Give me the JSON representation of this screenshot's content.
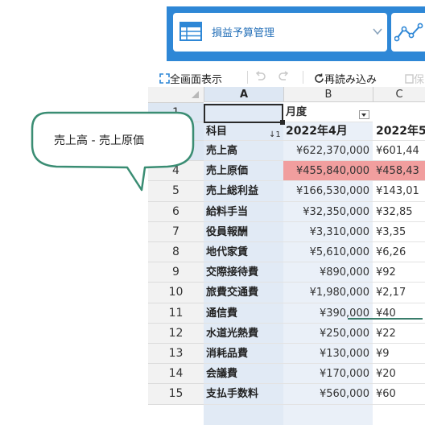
{
  "header": {
    "view_label": "損益予算管理",
    "colors": {
      "header_bg": "#2e87d6",
      "view_text": "#2570b8"
    }
  },
  "toolbar": {
    "fullscreen_label": "全画面表示",
    "reload_label": "再読み込み",
    "save_label": "保"
  },
  "sheet": {
    "columns": [
      "A",
      "B",
      "C"
    ],
    "header_row": {
      "row": "1",
      "b": "月度"
    },
    "label_row": {
      "row": "2",
      "a": "科目",
      "b": "2022年4月",
      "c": "2022年5"
    },
    "rows": [
      {
        "row": "3",
        "a": "売上高",
        "b": "¥622,370,000",
        "c": "¥601,44"
      },
      {
        "row": "4",
        "a": "売上原価",
        "b": "¥455,840,000",
        "c": "¥458,43"
      },
      {
        "row": "5",
        "a": "売上総利益",
        "b": "¥166,530,000",
        "c": "¥143,01"
      },
      {
        "row": "6",
        "a": "給料手当",
        "b": "¥32,350,000",
        "c": "¥32,85"
      },
      {
        "row": "7",
        "a": "役員報酬",
        "b": "¥3,310,000",
        "c": "¥3,35"
      },
      {
        "row": "8",
        "a": "地代家賃",
        "b": "¥5,610,000",
        "c": "¥6,26"
      },
      {
        "row": "9",
        "a": "交際接待費",
        "b": "¥890,000",
        "c": "¥92"
      },
      {
        "row": "10",
        "a": "旅費交通費",
        "b": "¥1,980,000",
        "c": "¥2,17"
      },
      {
        "row": "11",
        "a": "通信費",
        "b": "¥390,000",
        "c": "¥40"
      },
      {
        "row": "12",
        "a": "水道光熱費",
        "b": "¥250,000",
        "c": "¥22"
      },
      {
        "row": "13",
        "a": "消耗品費",
        "b": "¥130,000",
        "c": "¥9"
      },
      {
        "row": "14",
        "a": "会議費",
        "b": "¥170,000",
        "c": "¥20"
      },
      {
        "row": "15",
        "a": "支払手数料",
        "b": "¥560,000",
        "c": "¥60"
      }
    ],
    "highlight_color": "#f19e9e"
  },
  "callout": {
    "text": "売上高 - 売上原価"
  }
}
